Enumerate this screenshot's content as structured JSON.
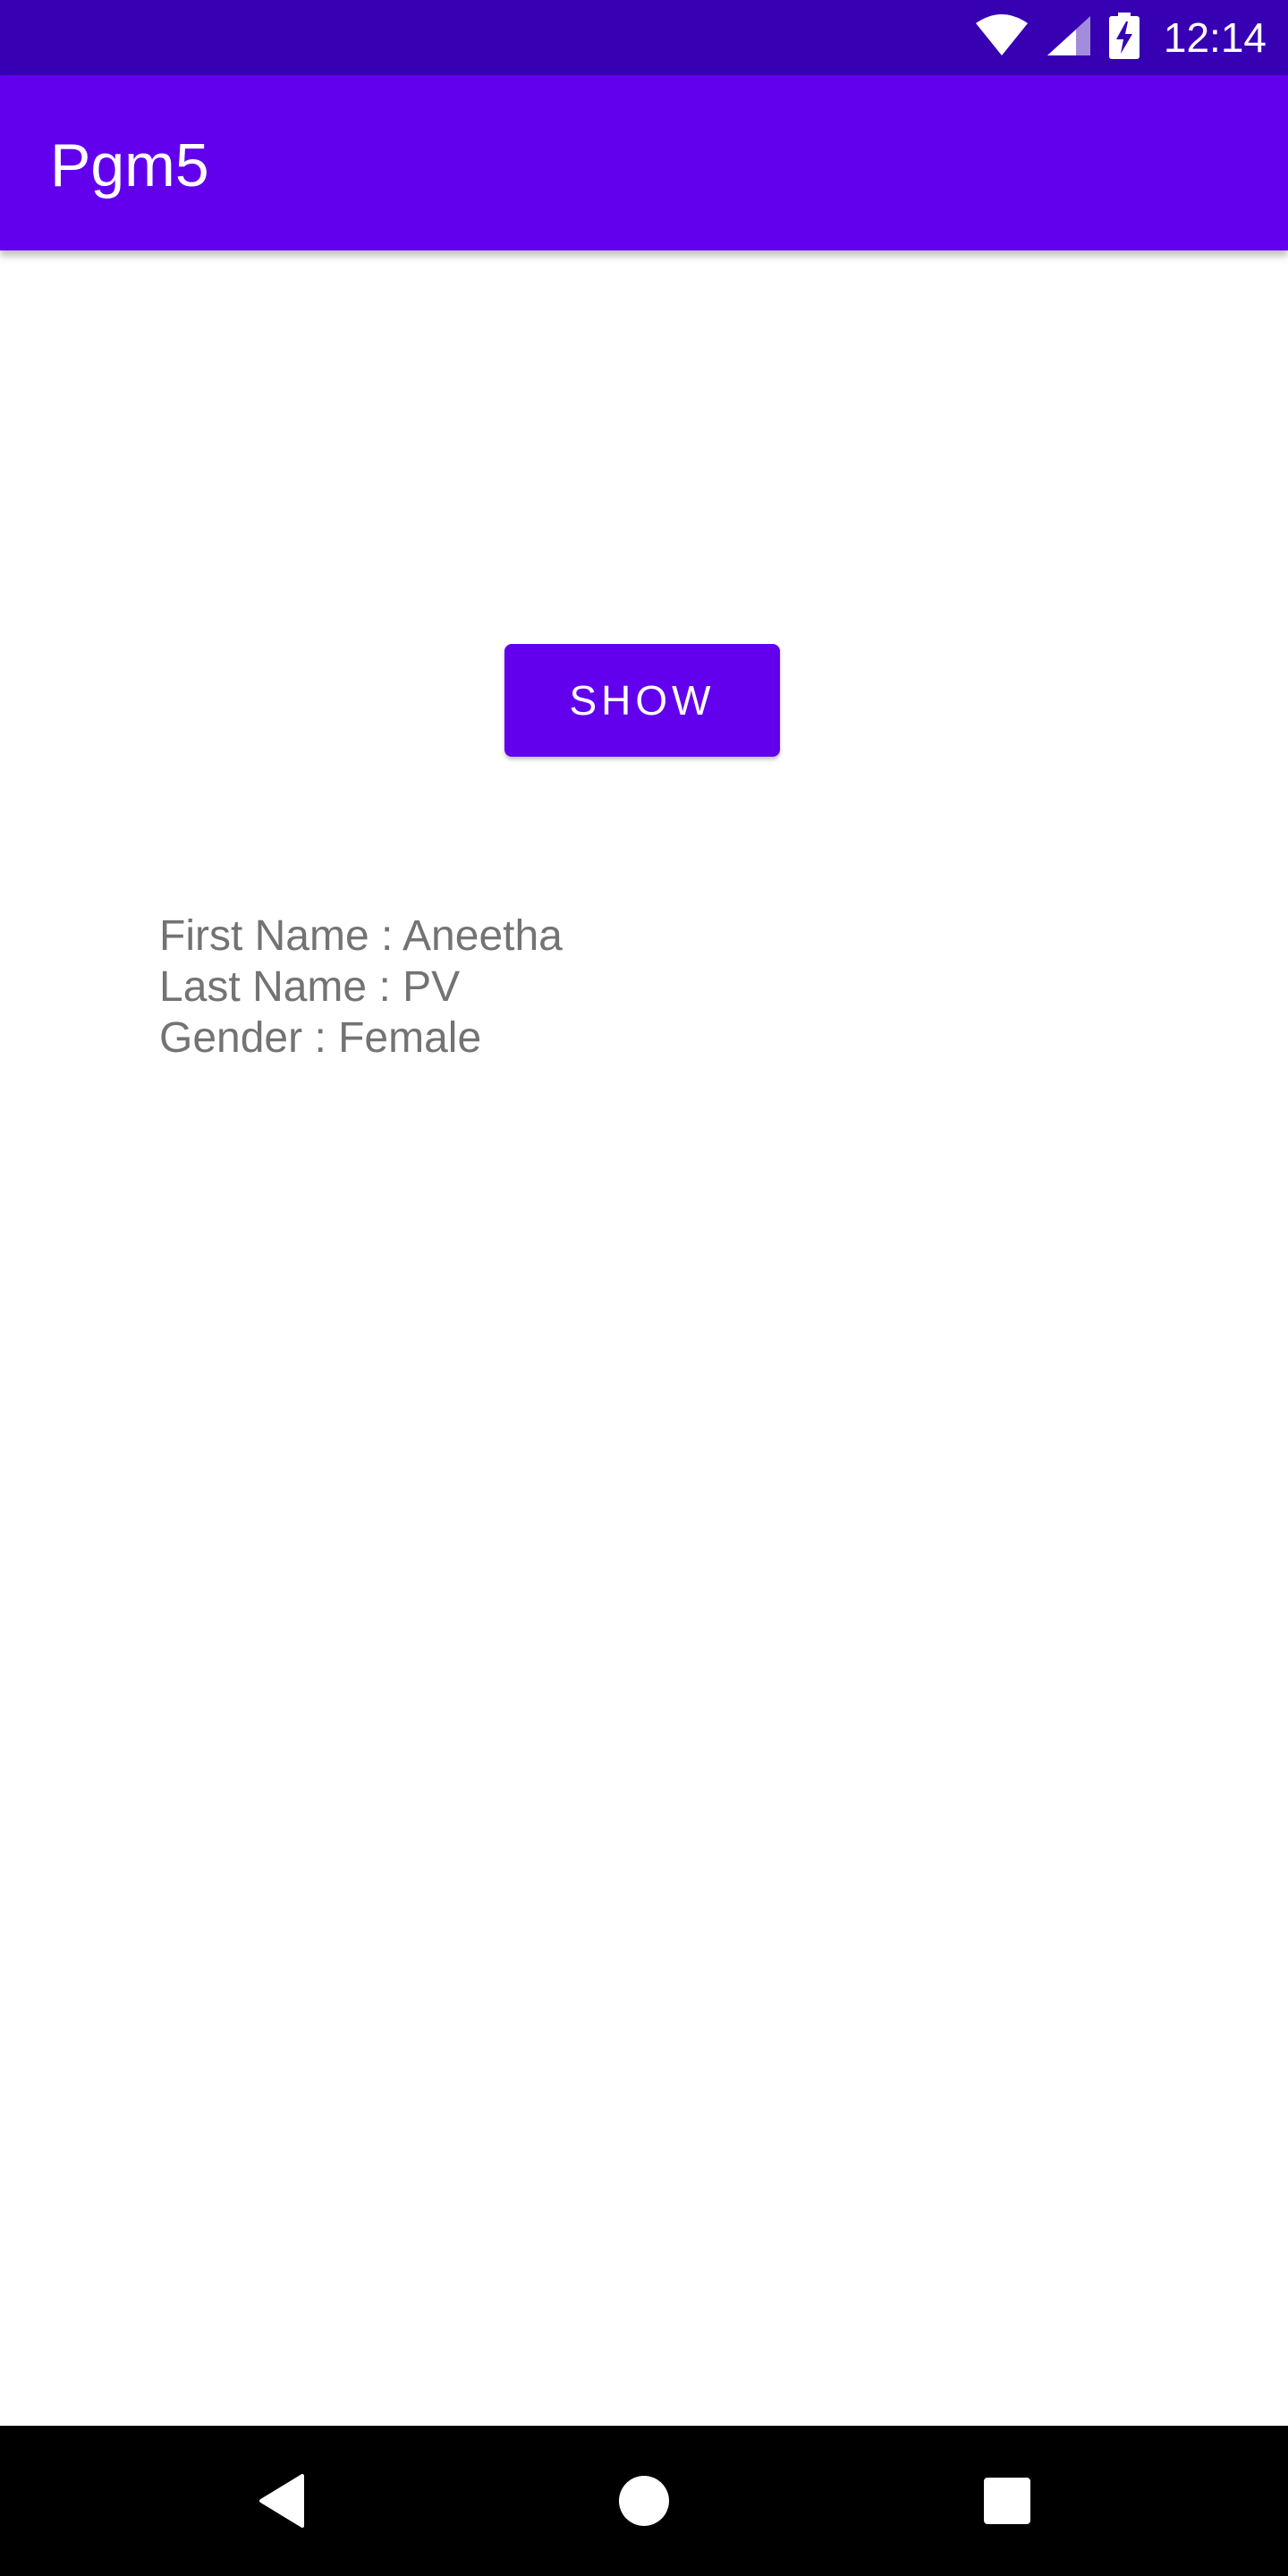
{
  "status_bar": {
    "time": "12:14",
    "icons": [
      "wifi-icon",
      "cellular-signal-icon",
      "battery-charging-icon"
    ],
    "background": "#3700b3"
  },
  "app_bar": {
    "title": "Pgm5",
    "background": "#6200ee"
  },
  "main": {
    "show_button_label": "SHOW",
    "info_lines": [
      "First Name : Aneetha",
      "Last Name : PV",
      "Gender : Female"
    ],
    "text_color": "#737373"
  },
  "nav_bar": {
    "buttons": [
      "back-icon",
      "home-icon",
      "recents-icon"
    ],
    "background": "#000000"
  }
}
